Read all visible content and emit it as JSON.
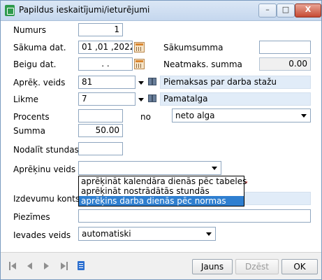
{
  "window": {
    "title": "Papildus ieskaitījumi/ieturējumi",
    "minimize_icon": "minimize-icon",
    "maximize_icon": "maximize-icon",
    "close_label": "X"
  },
  "form": {
    "numurs": {
      "label": "Numurs",
      "value": "1"
    },
    "sakuma_dat": {
      "label": "Sākuma dat.",
      "value": "01 ,01 ,2022"
    },
    "sakumsumma": {
      "label": "Sākumsumma",
      "value": ""
    },
    "beigu_dat": {
      "label": "Beigu dat.",
      "value": ".   ."
    },
    "neatmaks_summa": {
      "label": "Neatmaks. summa",
      "value": "0.00"
    },
    "aprek_veids": {
      "label": "Aprēķ. veids",
      "value": "81",
      "description": "Piemaksas par darba stažu"
    },
    "likme": {
      "label": "Likme",
      "value": "7",
      "description": "Pamatalga"
    },
    "procents": {
      "label": "Procents",
      "value": "",
      "no_label": "no",
      "base_value": "neto alga"
    },
    "summa": {
      "label": "Summa",
      "value": "50.00"
    },
    "nodalit_stundas": {
      "label": "Nodalīt stundas",
      "value": ""
    },
    "aprekinu_veids": {
      "label": "Aprēķinu veids",
      "value": "",
      "options": [
        "aprēķināt kalendāra dienās pēc tabeles",
        "aprēķināt nostrādātās stundās",
        "aprēķins darba dienās pēc normas"
      ],
      "highlighted_index": 2
    },
    "izdevumu_konts": {
      "label": "Izdevumu konts"
    },
    "piezimes": {
      "label": "Piezīmes",
      "value": ""
    },
    "ievades_veids": {
      "label": "Ievades veids",
      "value": "automatiski"
    }
  },
  "footer": {
    "new_label": "Jauns",
    "delete_label": "Dzēst",
    "ok_label": "OK"
  }
}
